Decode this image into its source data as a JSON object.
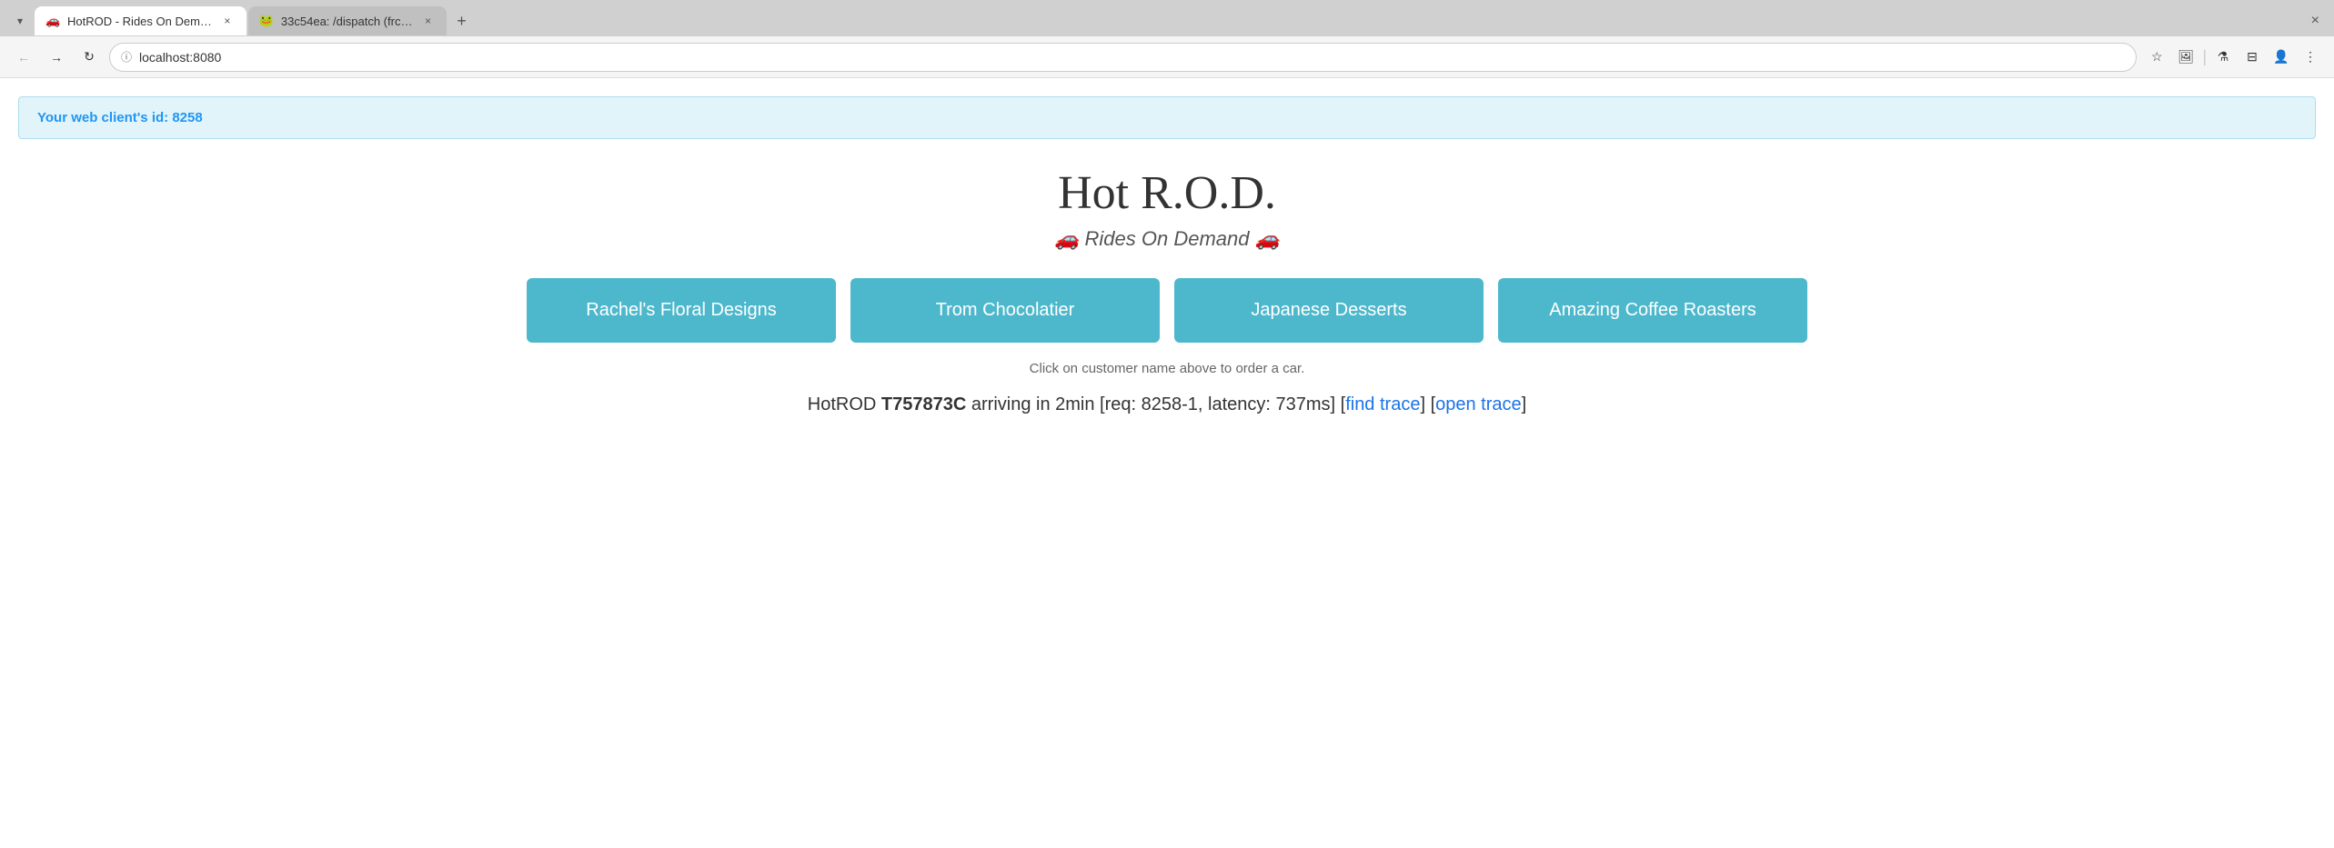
{
  "browser": {
    "tabs": [
      {
        "id": "tab1",
        "favicon": "🚗",
        "title": "HotROD - Rides On Dem…",
        "active": true,
        "close_label": "×"
      },
      {
        "id": "tab2",
        "favicon": "🐸",
        "title": "33c54ea: /dispatch (frc…",
        "active": false,
        "close_label": "×"
      }
    ],
    "new_tab_label": "+",
    "window_close_label": "×",
    "nav": {
      "back_label": "←",
      "forward_label": "→",
      "reload_label": "↻",
      "address": "localhost:8080",
      "address_icon": "ⓘ"
    },
    "nav_actions": {
      "star": "☆",
      "extension": "🖼",
      "separator": "|",
      "lab": "⚗",
      "cast": "⊟",
      "profile": "👤",
      "menu": "⋮"
    }
  },
  "page": {
    "client_id_banner": {
      "prefix": "Your web client's id: ",
      "id_value": "8258"
    },
    "app_title": "Hot R.O.D.",
    "app_subtitle_prefix": "🚗 ",
    "app_subtitle_text": "Rides On Demand",
    "app_subtitle_suffix": " 🚗",
    "customers": [
      {
        "id": "rachel",
        "label": "Rachel's Floral Designs"
      },
      {
        "id": "trom",
        "label": "Trom Chocolatier"
      },
      {
        "id": "japanese",
        "label": "Japanese Desserts"
      },
      {
        "id": "coffee",
        "label": "Amazing Coffee Roasters"
      }
    ],
    "instruction": "Click on customer name above to order a car.",
    "status": {
      "prefix": "HotROD ",
      "car_id": "T757873C",
      "middle": " arriving in 2min [req: 8258-1, latency: 737ms] [",
      "find_trace_label": "find trace",
      "find_trace_href": "#",
      "between": "] [",
      "open_trace_label": "open trace",
      "open_trace_href": "#",
      "suffix": "]"
    }
  }
}
